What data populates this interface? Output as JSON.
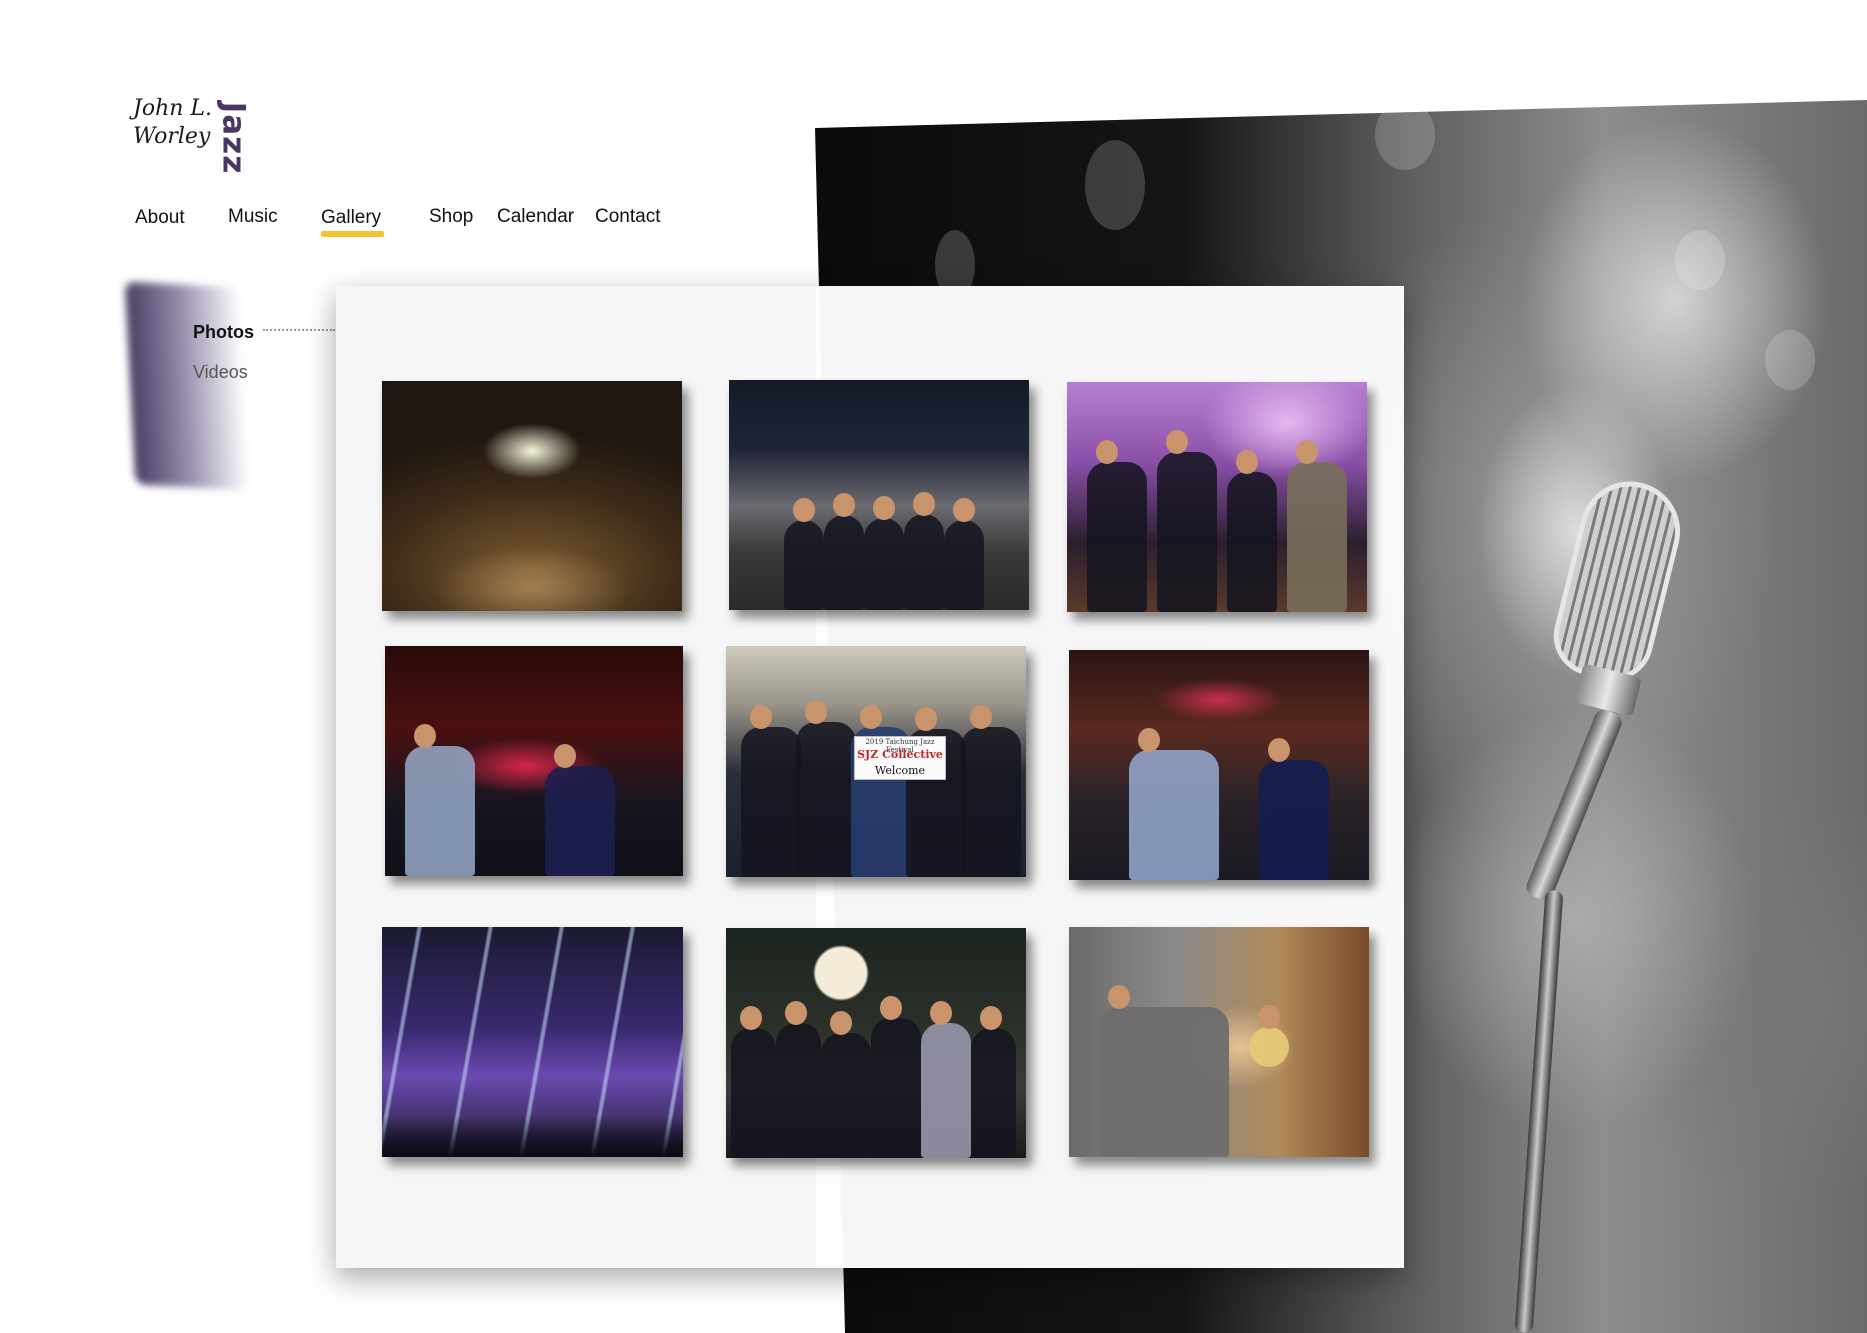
{
  "logo": {
    "line1": "John L.",
    "line2": "Worley",
    "word": "Jazz",
    "accent_color": "#4a3663"
  },
  "nav": {
    "items": [
      {
        "label": "About"
      },
      {
        "label": "Music"
      },
      {
        "label": "Gallery"
      },
      {
        "label": "Shop"
      },
      {
        "label": "Calendar"
      },
      {
        "label": "Contact"
      }
    ],
    "active": "Gallery",
    "active_color": "#f4c233"
  },
  "subnav": {
    "items": [
      {
        "label": "Photos",
        "selected": true
      },
      {
        "label": "Videos",
        "selected": false
      }
    ]
  },
  "gallery": {
    "photos": [
      {
        "subject": "festival-crowd-aerial"
      },
      {
        "subject": "band-on-stage-crowd"
      },
      {
        "subject": "saxophone-band-backstage"
      },
      {
        "subject": "blue-note-guitar-trumpet"
      },
      {
        "subject": "airport-welcome-sign",
        "sign_lines": [
          "2019 Taichung Jazz Festival",
          "SJZ Collective",
          "Welcome"
        ]
      },
      {
        "subject": "blue-note-trumpet-solo"
      },
      {
        "subject": "stage-light-show"
      },
      {
        "subject": "night-street-group"
      },
      {
        "subject": "trumpet-player-hat"
      }
    ]
  }
}
